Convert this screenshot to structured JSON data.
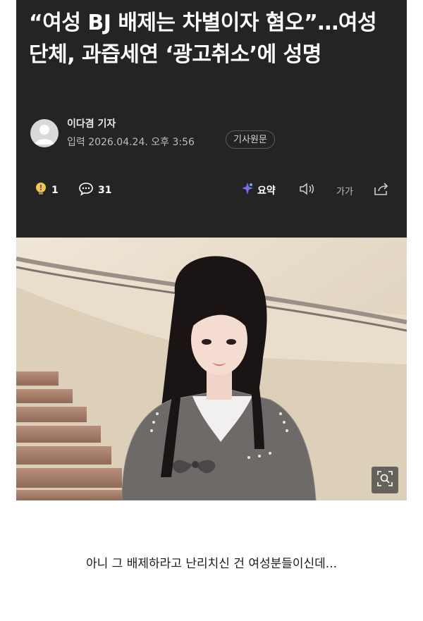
{
  "article": {
    "headline": "“여성 BJ 배제는 차별이자 혐오”…여성단체, 과즙세연 ‘광고취소’에 성명",
    "reporter": "이다겸 기자",
    "dateline": "입력 2026.04.24. 오후 3:56",
    "origin_button": "기사원문"
  },
  "actions": {
    "reaction_count": "1",
    "comment_count": "31",
    "summary_label": "요약",
    "font_size_label": "가가"
  },
  "icons": {
    "reaction": "lightbulb-icon",
    "comment": "speech-bubble-icon",
    "summary": "ai-sparkle-icon",
    "listen": "speaker-icon",
    "font_size": "text-size-icon",
    "share": "share-icon",
    "zoom": "zoom-search-icon"
  },
  "colors": {
    "card_background": "#242424",
    "page_background": "#ffffff",
    "summary_icon": "#7c6cf0"
  },
  "caption": "아니 그 배제하라고 난리치신 건 여성분들이신데..."
}
